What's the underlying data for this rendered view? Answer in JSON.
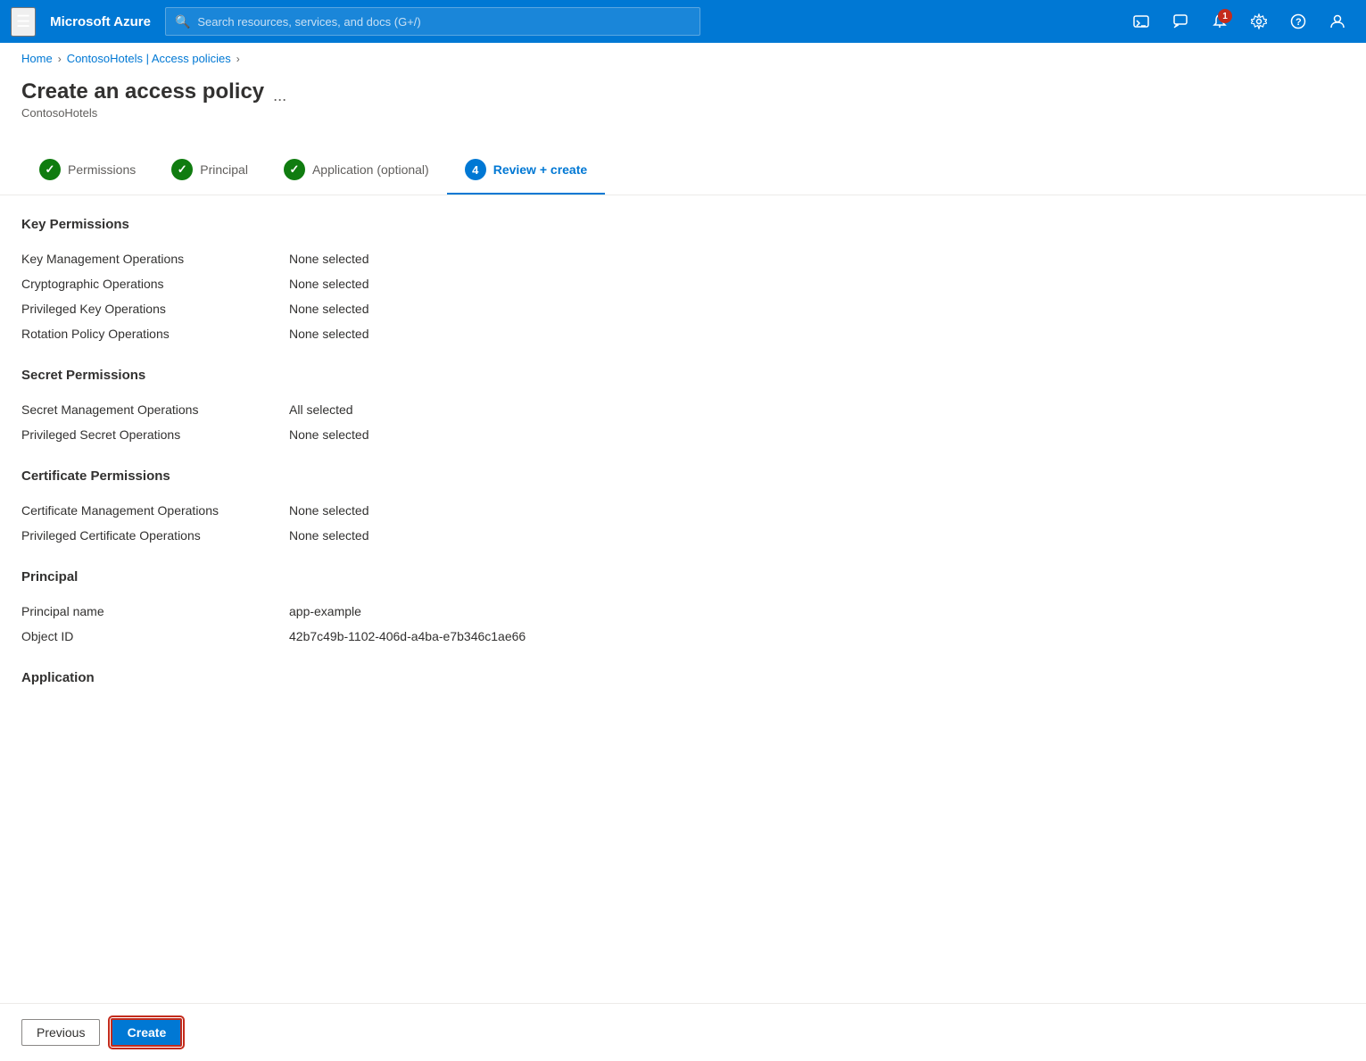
{
  "topnav": {
    "brand": "Microsoft Azure",
    "search_placeholder": "Search resources, services, and docs (G+/)",
    "notification_count": "1"
  },
  "breadcrumb": {
    "home": "Home",
    "parent": "ContosoHotels | Access policies"
  },
  "page": {
    "title": "Create an access policy",
    "subtitle": "ContosoHotels",
    "more_label": "..."
  },
  "wizard": {
    "steps": [
      {
        "id": "permissions",
        "label": "Permissions",
        "state": "completed"
      },
      {
        "id": "principal",
        "label": "Principal",
        "state": "completed"
      },
      {
        "id": "application",
        "label": "Application (optional)",
        "state": "completed"
      },
      {
        "id": "review",
        "label": "Review + create",
        "state": "active",
        "number": "4"
      }
    ]
  },
  "sections": {
    "key_permissions": {
      "title": "Key Permissions",
      "rows": [
        {
          "label": "Key Management Operations",
          "value": "None selected"
        },
        {
          "label": "Cryptographic Operations",
          "value": "None selected"
        },
        {
          "label": "Privileged Key Operations",
          "value": "None selected"
        },
        {
          "label": "Rotation Policy Operations",
          "value": "None selected"
        }
      ]
    },
    "secret_permissions": {
      "title": "Secret Permissions",
      "rows": [
        {
          "label": "Secret Management Operations",
          "value": "All selected"
        },
        {
          "label": "Privileged Secret Operations",
          "value": "None selected"
        }
      ]
    },
    "certificate_permissions": {
      "title": "Certificate Permissions",
      "rows": [
        {
          "label": "Certificate Management Operations",
          "value": "None selected"
        },
        {
          "label": "Privileged Certificate Operations",
          "value": "None selected"
        }
      ]
    },
    "principal": {
      "title": "Principal",
      "rows": [
        {
          "label": "Principal name",
          "value": "app-example"
        },
        {
          "label": "Object ID",
          "value": "42b7c49b-1102-406d-a4ba-e7b346c1ae66"
        }
      ]
    },
    "application": {
      "title": "Application"
    }
  },
  "footer": {
    "previous_label": "Previous",
    "create_label": "Create"
  }
}
